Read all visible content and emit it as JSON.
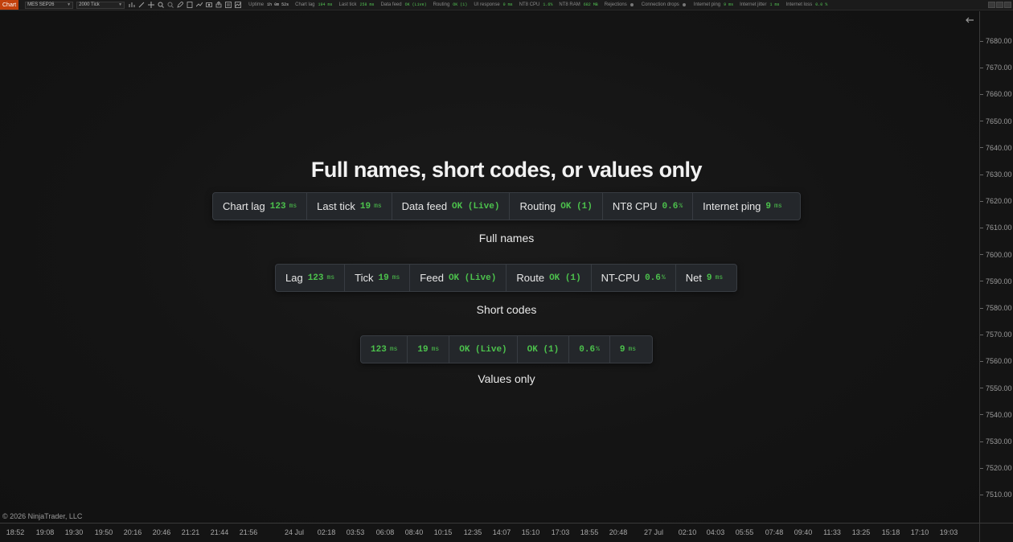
{
  "toolbar": {
    "tab_label": "Chart",
    "instrument": "MES SEP26",
    "interval": "2000 Tick",
    "uptime_label": "Uptime",
    "uptime_value": "1h 0m 52s",
    "metrics": [
      {
        "label": "Chart lag",
        "value": "194 ms",
        "tone": "green"
      },
      {
        "label": "Last tick",
        "value": "258 ms",
        "tone": "green"
      },
      {
        "label": "Data feed",
        "value": "OK (Live)",
        "tone": "green"
      },
      {
        "label": "Routing",
        "value": "OK (1)",
        "tone": "green"
      },
      {
        "label": "UI response",
        "value": "0 ms",
        "tone": "green"
      },
      {
        "label": "NT8 CPU",
        "value": "1.6%",
        "tone": "green"
      },
      {
        "label": "NT8 RAM",
        "value": "682 MB",
        "tone": "green"
      },
      {
        "label": "Rejections",
        "value": "",
        "tone": "dot"
      },
      {
        "label": "Connection drops",
        "value": "",
        "tone": "dot"
      },
      {
        "label": "Internet ping",
        "value": "9 ms",
        "tone": "green"
      },
      {
        "label": "Internet jitter",
        "value": "1 ms",
        "tone": "green"
      },
      {
        "label": "Internet loss",
        "value": "0.0 %",
        "tone": "green"
      }
    ]
  },
  "headline": "Full names, short codes, or values only",
  "full_names": {
    "caption": "Full names",
    "items": [
      {
        "label": "Chart lag",
        "value": "123",
        "unit": "ms"
      },
      {
        "label": "Last tick",
        "value": "19",
        "unit": "ms"
      },
      {
        "label": "Data feed",
        "value": "OK (Live)",
        "unit": ""
      },
      {
        "label": "Routing",
        "value": "OK (1)",
        "unit": ""
      },
      {
        "label": "NT8 CPU",
        "value": "0.6",
        "unit": "%"
      },
      {
        "label": "Internet ping",
        "value": "9",
        "unit": "ms"
      }
    ]
  },
  "short_codes": {
    "caption": "Short codes",
    "items": [
      {
        "label": "Lag",
        "value": "123",
        "unit": "ms"
      },
      {
        "label": "Tick",
        "value": "19",
        "unit": "ms"
      },
      {
        "label": "Feed",
        "value": "OK (Live)",
        "unit": ""
      },
      {
        "label": "Route",
        "value": "OK (1)",
        "unit": ""
      },
      {
        "label": "NT-CPU",
        "value": "0.6",
        "unit": "%"
      },
      {
        "label": "Net",
        "value": "9",
        "unit": "ms"
      }
    ]
  },
  "values_only": {
    "caption": "Values only",
    "items": [
      {
        "label": "",
        "value": "123",
        "unit": "ms"
      },
      {
        "label": "",
        "value": "19",
        "unit": "ms"
      },
      {
        "label": "",
        "value": "OK (Live)",
        "unit": ""
      },
      {
        "label": "",
        "value": "OK (1)",
        "unit": ""
      },
      {
        "label": "",
        "value": "0.6",
        "unit": "%"
      },
      {
        "label": "",
        "value": "9",
        "unit": "ms"
      }
    ]
  },
  "price_axis": [
    "7680.00",
    "7670.00",
    "7660.00",
    "7650.00",
    "7640.00",
    "7630.00",
    "7620.00",
    "7610.00",
    "7600.00",
    "7590.00",
    "7580.00",
    "7570.00",
    "7560.00",
    "7550.00",
    "7540.00",
    "7530.00",
    "7520.00",
    "7510.00"
  ],
  "time_axis": [
    "18:52",
    "19:08",
    "19:30",
    "19:50",
    "20:16",
    "20:46",
    "21:21",
    "21:44",
    "21:56",
    "24 Jul",
    "02:18",
    "03:53",
    "06:08",
    "08:40",
    "10:15",
    "12:35",
    "14:07",
    "15:10",
    "17:03",
    "18:55",
    "20:48",
    "27 Jul",
    "02:10",
    "04:03",
    "05:55",
    "07:48",
    "09:40",
    "11:33",
    "13:25",
    "15:18",
    "17:10",
    "19:03"
  ],
  "copyright": "© 2026 NinjaTrader, LLC",
  "colors": {
    "accent_green": "#4cc24c",
    "tab_orange": "#c2410c",
    "background": "#131313"
  }
}
